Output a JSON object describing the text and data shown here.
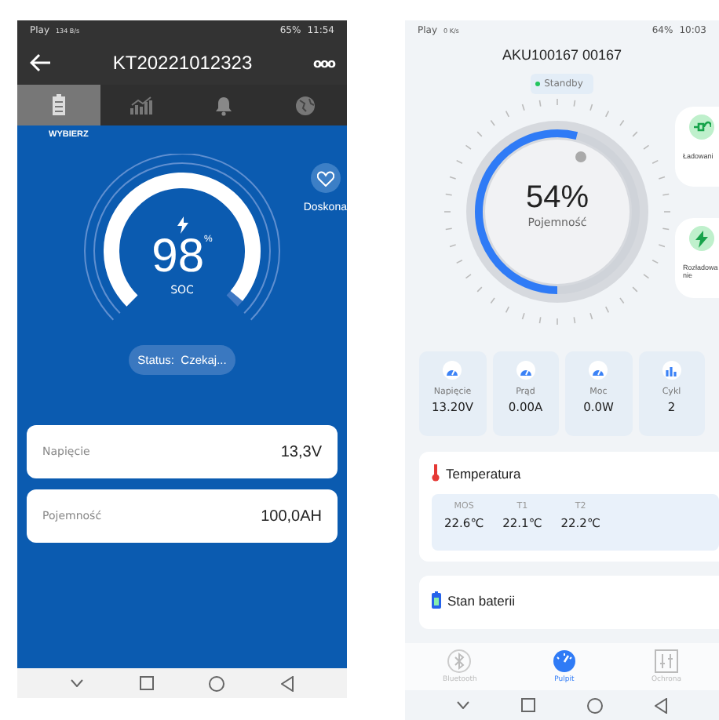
{
  "left_phone": {
    "status_bar": {
      "carrier": "Play",
      "speed": "134 B/s",
      "battery": "65%",
      "time": "11:54"
    },
    "header": {
      "title": "KT20221012323",
      "menu": "ooo"
    },
    "tabs": [
      {
        "selected": true
      },
      {
        "selected": false
      },
      {
        "selected": false
      },
      {
        "selected": false
      }
    ],
    "section_label": "WYBIERZ",
    "health": {
      "label": "Doskona"
    },
    "gauge": {
      "value": "98",
      "unit": "%",
      "label": "SOC",
      "level": 0.98
    },
    "status": "Status:  Czekaj...",
    "rows": [
      {
        "label": "Napięcie",
        "value": "13,3V"
      },
      {
        "label": "Pojemność",
        "value": "100,0AH"
      }
    ]
  },
  "right_phone": {
    "status_bar": {
      "carrier": "Play",
      "speed": "0 K/s",
      "battery": "64%",
      "time": "10:03"
    },
    "title": "AKU100167  00167",
    "state": "Standby",
    "gauge": {
      "value": "54%",
      "label": "Pojemność",
      "level": 0.54
    },
    "side_buttons": [
      {
        "label": "Ładowani",
        "kind": "plug"
      },
      {
        "label": "Rozładowa nie",
        "kind": "bolt"
      }
    ],
    "metrics": [
      {
        "label": "Napięcie",
        "value": "13.20V",
        "kind": "gauge"
      },
      {
        "label": "Prąd",
        "value": "0.00A",
        "kind": "gauge"
      },
      {
        "label": "Moc",
        "value": "0.0W",
        "kind": "gauge"
      },
      {
        "label": "Cykl",
        "value": "2",
        "kind": "bars"
      }
    ],
    "temperature": {
      "title": "Temperatura",
      "sensors": [
        {
          "label": "MOS",
          "value": "22.6℃"
        },
        {
          "label": "T1",
          "value": "22.1℃"
        },
        {
          "label": "T2",
          "value": "22.2℃"
        }
      ]
    },
    "battery_state": {
      "title": "Stan baterii"
    },
    "bottom_nav": [
      {
        "label": "Bluetooth",
        "selected": false
      },
      {
        "label": "Pulpit",
        "selected": true
      },
      {
        "label": "Ochrona",
        "selected": false
      }
    ]
  }
}
